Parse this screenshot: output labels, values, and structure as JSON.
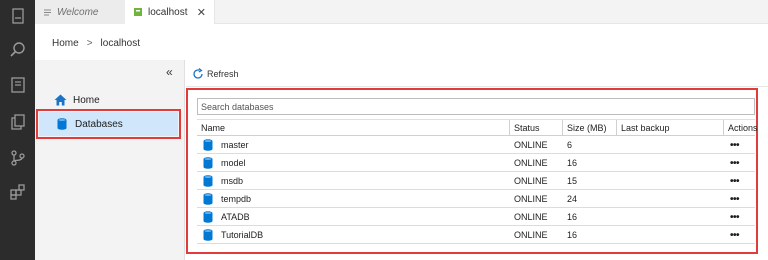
{
  "tabs": [
    {
      "label": "Welcome",
      "icon": "menu-lines-icon"
    },
    {
      "label": "localhost",
      "icon": "server-icon",
      "close": "✕"
    }
  ],
  "breadcrumb": {
    "root": "Home",
    "separator": ">",
    "current": "localhost"
  },
  "sidebar": {
    "collapse": "«",
    "items": [
      {
        "label": "Home",
        "icon": "home-icon"
      },
      {
        "label": "Databases",
        "icon": "database-icon",
        "selected": true
      }
    ]
  },
  "toolbar": {
    "refresh_label": "Refresh"
  },
  "search": {
    "placeholder": "Search databases",
    "value": ""
  },
  "table": {
    "columns": [
      "Name",
      "Status",
      "Size (MB)",
      "Last backup",
      "Actions"
    ],
    "rows": [
      {
        "name": "master",
        "status": "ONLINE",
        "size": "6",
        "last_backup": "",
        "actions": "•••"
      },
      {
        "name": "model",
        "status": "ONLINE",
        "size": "16",
        "last_backup": "",
        "actions": "•••"
      },
      {
        "name": "msdb",
        "status": "ONLINE",
        "size": "15",
        "last_backup": "",
        "actions": "•••"
      },
      {
        "name": "tempdb",
        "status": "ONLINE",
        "size": "24",
        "last_backup": "",
        "actions": "•••"
      },
      {
        "name": "ATADB",
        "status": "ONLINE",
        "size": "16",
        "last_backup": "",
        "actions": "•••"
      },
      {
        "name": "TutorialDB",
        "status": "ONLINE",
        "size": "16",
        "last_backup": "",
        "actions": "•••"
      }
    ]
  },
  "colors": {
    "accent": "#0078d4",
    "highlight": "#e03c3c",
    "selected_bg": "#cfe6fb",
    "activity_bar": "#2c2c2c"
  }
}
